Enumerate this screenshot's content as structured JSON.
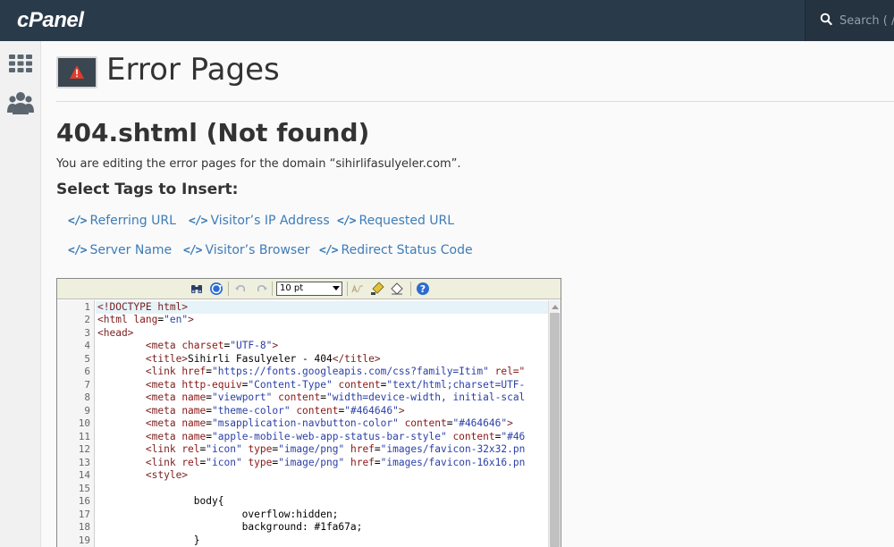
{
  "app": {
    "logo": "cPanel",
    "search_placeholder": "Search ( / )"
  },
  "sidebar": {
    "items": [
      {
        "icon": "grid-icon"
      },
      {
        "icon": "users-icon"
      }
    ]
  },
  "header": {
    "title": "Error Pages"
  },
  "main": {
    "sub_title": "404.shtml (Not found)",
    "description": "You are editing the error pages for the domain “sihirlifasulyeler.com”.",
    "tags_title": "Select Tags to Insert:",
    "tags": [
      {
        "label": "Referring URL"
      },
      {
        "label": "Visitor’s IP Address"
      },
      {
        "label": "Requested URL"
      },
      {
        "label": "Server Name"
      },
      {
        "label": "Visitor’s Browser"
      },
      {
        "label": "Redirect Status Code"
      }
    ],
    "tag_icon": "</>"
  },
  "editor": {
    "font_size": "10 pt",
    "lines": [
      "1",
      "2",
      "3",
      "4",
      "5",
      "6",
      "7",
      "8",
      "9",
      "10",
      "11",
      "12",
      "13",
      "14",
      "15",
      "16",
      "17",
      "18",
      "19"
    ],
    "code": {
      "l1_tag": "<!DOCTYPE html>",
      "l2_open": "<html ",
      "l2_attr": "lang",
      "l2_eq": "=",
      "l2_val": "\"en\"",
      "l2_close": ">",
      "l3": "<head>",
      "l4_indent": "        ",
      "l4_open": "<meta ",
      "l4_attr": "charset",
      "l4_eq": "=",
      "l4_val": "\"UTF-8\"",
      "l4_close": ">",
      "l5_indent": "        ",
      "l5_open": "<title>",
      "l5_text": "Sihirli Fasulyeler - 404",
      "l5_close": "</title>",
      "l6_indent": "        ",
      "l6_open": "<link ",
      "l6_attr": "href",
      "l6_eq": "=",
      "l6_val": "\"https://fonts.googleapis.com/css?family=Itim\"",
      "l6_rest": " rel=\"",
      "l7_indent": "        ",
      "l7_open": "<meta ",
      "l7_attr": "http-equiv",
      "l7_eq": "=",
      "l7_val": "\"Content-Type\"",
      "l7_attr2": " content",
      "l7_eq2": "=",
      "l7_val2": "\"text/html;charset=UTF-",
      "l8_indent": "        ",
      "l8_open": "<meta ",
      "l8_attr": "name",
      "l8_eq": "=",
      "l8_val": "\"viewport\"",
      "l8_attr2": " content",
      "l8_eq2": "=",
      "l8_val2": "\"width=device-width, initial-scal",
      "l9_indent": "        ",
      "l9_open": "<meta ",
      "l9_attr": "name",
      "l9_eq": "=",
      "l9_val": "\"theme-color\"",
      "l9_attr2": " content",
      "l9_eq2": "=",
      "l9_val2": "\"#464646\"",
      "l9_close": ">",
      "l10_indent": "        ",
      "l10_open": "<meta ",
      "l10_attr": "name",
      "l10_eq": "=",
      "l10_val": "\"msapplication-navbutton-color\"",
      "l10_attr2": " content",
      "l10_eq2": "=",
      "l10_val2": "\"#464646\"",
      "l10_close": ">",
      "l11_indent": "        ",
      "l11_open": "<meta ",
      "l11_attr": "name",
      "l11_eq": "=",
      "l11_val": "\"apple-mobile-web-app-status-bar-style\"",
      "l11_attr2": " content",
      "l11_eq2": "=",
      "l11_val2": "\"#46",
      "l12_indent": "        ",
      "l12_open": "<link ",
      "l12_attr": "rel",
      "l12_eq": "=",
      "l12_val": "\"icon\"",
      "l12_attr2": " type",
      "l12_eq2": "=",
      "l12_val2": "\"image/png\"",
      "l12_attr3": " href",
      "l12_eq3": "=",
      "l12_val3": "\"images/favicon-32x32.pn",
      "l13_indent": "        ",
      "l13_open": "<link ",
      "l13_attr": "rel",
      "l13_eq": "=",
      "l13_val": "\"icon\"",
      "l13_attr2": " type",
      "l13_eq2": "=",
      "l13_val2": "\"image/png\"",
      "l13_attr3": " href",
      "l13_eq3": "=",
      "l13_val3": "\"images/favicon-16x16.pn",
      "l14_indent": "        ",
      "l14_open": "<style>",
      "l16": "                body{",
      "l17": "                        overflow:hidden;",
      "l18": "                        background: #1fa67a;",
      "l19": "                }"
    }
  },
  "colors": {
    "topbar": "#293a4a",
    "link": "#3d7cb8",
    "warning": "#e03c2b"
  }
}
